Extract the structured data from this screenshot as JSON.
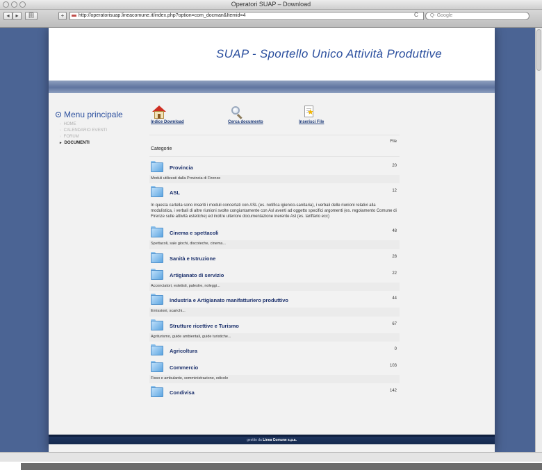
{
  "window": {
    "title": "Operatori SUAP – Download"
  },
  "browser": {
    "url": "http://operatorisuap.lineacomune.it/index.php?option=com_docman&Itemid=4",
    "search_placeholder": "Q- Google",
    "back_label": "◂",
    "forward_label": "▸",
    "bookmark_label": "田",
    "add_label": "+",
    "reload_label": "C"
  },
  "site": {
    "title": "SUAP - Sportello Unico Attività Produttive"
  },
  "menu": {
    "title": "Menu principale",
    "items": [
      {
        "label": "HOME"
      },
      {
        "label": "CALENDARIO EVENTI"
      },
      {
        "label": "FORUM"
      },
      {
        "label": "DOCUMENTI",
        "active": true
      }
    ]
  },
  "actions": {
    "home": {
      "label": "Indice Download",
      "icon": "home-icon"
    },
    "search": {
      "label": "Cerca documento",
      "icon": "search-icon"
    },
    "upload": {
      "label": "Inserisci File",
      "icon": "file-star-icon"
    }
  },
  "list": {
    "header_category": "Categorie",
    "header_files": "File",
    "categories": [
      {
        "name": "Provincia",
        "count": "20",
        "description": "Moduli utilizzati dalla Provincia di Firenze"
      },
      {
        "name": "ASL",
        "count": "12",
        "description": "In questa cartella sono inseriti i moduli concertati con ASL (es. notifica igienico-sanitaria), i verbali delle riunioni relativi alla modulistica, i verbali di altre riunioni svolte congiuntamente con Asl aventi ad oggetto specifici argomenti (es. regolamento Comune di Firenze sulle attività estetiche) ed inoltre ulteriore documentazione inerente Asl (es. tariffario ecc)"
      },
      {
        "name": "Cinema e spettacoli",
        "count": "48",
        "description": "Spettacoli, sale giochi, discoteche, cinema..."
      },
      {
        "name": "Sanità e Istruzione",
        "count": "28",
        "description": ""
      },
      {
        "name": "Artigianato di servizio",
        "count": "22",
        "description": "Acconciatori, estetisti, palestre, noleggi..."
      },
      {
        "name": "Industria e Artigianato manifatturiero produttivo",
        "count": "44",
        "description": "Emissioni, scarichi..."
      },
      {
        "name": "Strutture ricettive e Turismo",
        "count": "67",
        "description": "Agriturismo, guide ambientali, guide turistiche..."
      },
      {
        "name": "Agricoltura",
        "count": "0",
        "description": ""
      },
      {
        "name": "Commercio",
        "count": "103",
        "description": "Fisso e ambulante, somministrazione, edicole"
      },
      {
        "name": "Condivisa",
        "count": "142",
        "description": ""
      }
    ]
  },
  "footer": {
    "prefix": "gestito da",
    "company": "Linea Comune s.p.a."
  },
  "colors": {
    "outer_background": "#4b6494",
    "title_blue": "#2b4f9e",
    "link_navy": "#1a2f6b",
    "footer_navy": "#1e345e"
  }
}
